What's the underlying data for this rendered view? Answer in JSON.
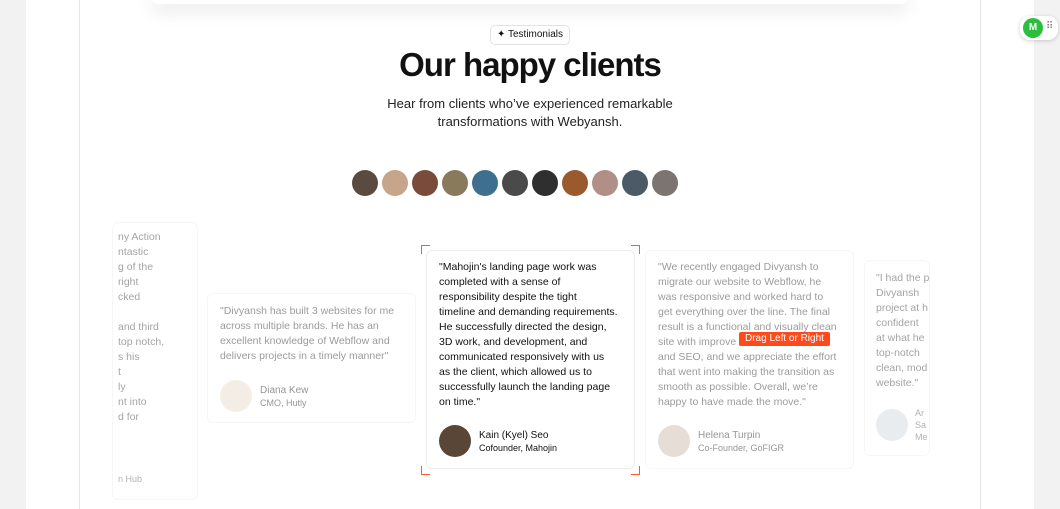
{
  "section": {
    "badge": "✦ Testimonials",
    "title": "Our happy clients",
    "subtitle_line1": "Hear from clients who’ve experienced remarkable",
    "subtitle_line2": "transformations with Webyansh."
  },
  "avatar_colors": [
    "#5b4a3f",
    "#c7a58a",
    "#7a4b3a",
    "#8a7a5c",
    "#3e6f8f",
    "#4a4a4a",
    "#2f2f2f",
    "#9a5a2e",
    "#b08f86",
    "#4b5a66",
    "#7b7470"
  ],
  "left_partial": {
    "lines": [
      "ny Action",
      "ntastic",
      "g of the",
      "right",
      "cked",
      "",
      "and third",
      "top notch,",
      "s his",
      "t",
      "ly",
      "nt into",
      "d for"
    ],
    "footer": "n Hub"
  },
  "testimonials": [
    {
      "quote_lines": [
        "\"Divyansh has built 3 websites for me",
        "across multiple brands. He has an",
        "excellent knowledge of Webflow and",
        "delivers projects in a timely manner\""
      ],
      "name": "Diana Kew",
      "role": "CMO, Hutly",
      "avatar_color": "#e6d8ca"
    },
    {
      "quote_lines": [
        "\"Mahojin's landing page work was",
        "completed with a sense of",
        "responsibility despite the tight",
        "timeline and demanding requirements.",
        "He successfully directed the design,",
        "3D work, and development, and",
        "communicated responsively with us",
        "as the client, which allowed us to",
        "successfully launch the landing page",
        "on time.\""
      ],
      "name": "Kain (Kyel) Seo",
      "role": "Cofounder, Mahojin",
      "avatar_color": "#5a4636"
    },
    {
      "quote_lines": [
        "\"We recently engaged Divyansh to",
        "migrate our website to Webflow, he",
        "was responsive and worked hard to",
        "get everything over the line. The final",
        "result is a functional and visually clean",
        "site with improve",
        "and SEO, and we appreciate the effort",
        "that went into making the transition as",
        "smooth as possible. Overall, we’re",
        "happy to have made the move.\""
      ],
      "name": "Helena Turpin",
      "role": "Co-Founder, GoFIGR",
      "avatar_color": "#c9b7a6"
    }
  ],
  "right_partial": {
    "lines": [
      "\"I had the p",
      "Divyansh",
      "project at h",
      "confident",
      "at what he",
      "top-notch",
      "clean, mod",
      "website.\""
    ],
    "name_lines": [
      "Ar",
      "Sa",
      "Me"
    ]
  },
  "drag_hint": "Drag Left or Right",
  "widget": {
    "logo": "M",
    "grip": "⠿",
    "color": "#2bbf3d"
  }
}
